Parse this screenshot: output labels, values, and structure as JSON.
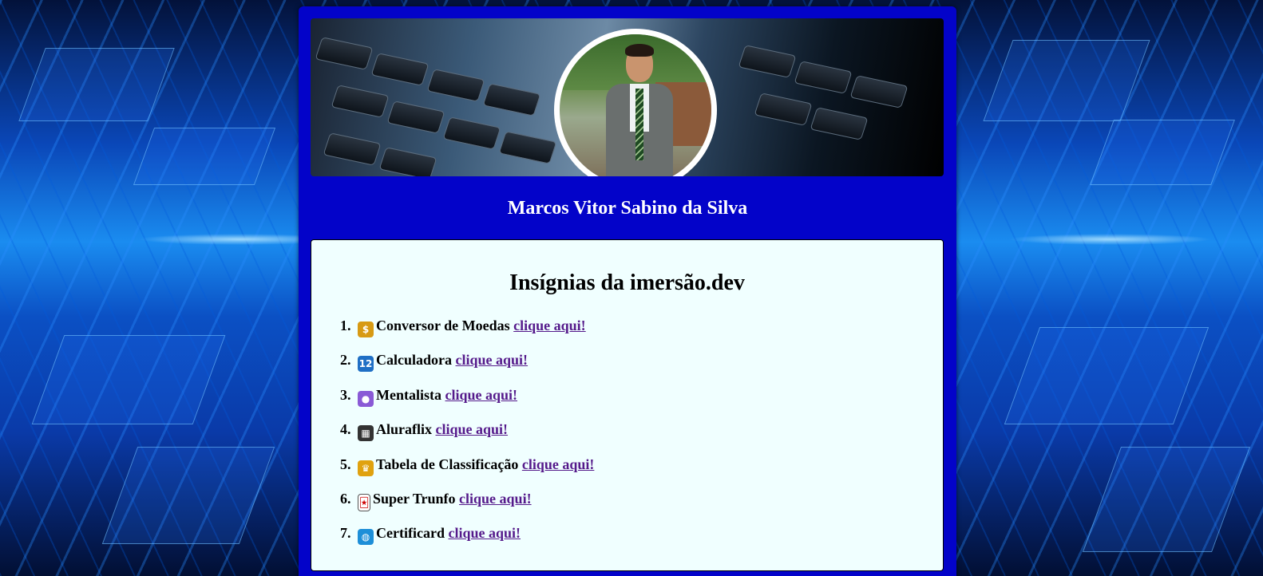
{
  "profile": {
    "name": "Marcos Vitor Sabino da Silva"
  },
  "badges_section": {
    "title": "Insígnias da imersão.dev",
    "items": [
      {
        "number": "1.",
        "icon": "money-bag-icon",
        "glyph": "$",
        "color": "#d79a14",
        "label": "Conversor de Moedas",
        "link": "clique aqui!"
      },
      {
        "number": "2.",
        "icon": "calculator-icon",
        "glyph": "12",
        "color": "#1f6fc5",
        "label": "Calculadora",
        "link": "clique aqui!"
      },
      {
        "number": "3.",
        "icon": "crystal-ball-icon",
        "glyph": "●",
        "color": "#8a5ad6",
        "label": "Mentalista",
        "link": "clique aqui!"
      },
      {
        "number": "4.",
        "icon": "clapperboard-icon",
        "glyph": "▦",
        "color": "#333333",
        "label": "Aluraflix",
        "link": "clique aqui!"
      },
      {
        "number": "5.",
        "icon": "trophy-icon",
        "glyph": "♛",
        "color": "#e0a210",
        "label": "Tabela de Classificação",
        "link": "clique aqui!"
      },
      {
        "number": "6.",
        "icon": "joker-card-icon",
        "glyph": "🃏",
        "color": "#ffffff",
        "label": "Super Trunfo",
        "link": "clique aqui!"
      },
      {
        "number": "7.",
        "icon": "globe-icon",
        "glyph": "◍",
        "color": "#1e8fd8",
        "label": "Certificard",
        "link": "clique aqui!"
      }
    ]
  },
  "colors": {
    "card_background": "#0303c9",
    "panel_background": "#f0ffff",
    "link": "#551a8b"
  }
}
